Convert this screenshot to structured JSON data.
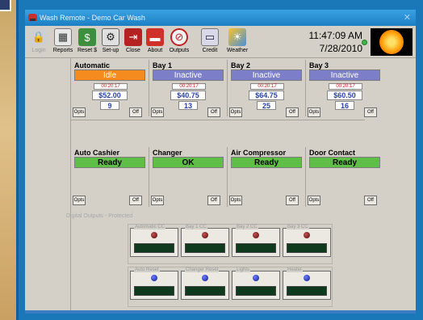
{
  "window": {
    "title": "Wash Remote - Demo Car Wash"
  },
  "toolbar": {
    "buttons": [
      {
        "label": "Login",
        "icon": "lock-icon",
        "enabled": false
      },
      {
        "label": "Reports",
        "icon": "calculator-icon",
        "enabled": true
      },
      {
        "label": "Reset $",
        "icon": "money-icon",
        "enabled": true
      },
      {
        "label": "Set-up",
        "icon": "setup-icon",
        "enabled": true
      },
      {
        "label": "Close",
        "icon": "exit-door-icon",
        "enabled": true
      },
      {
        "label": "About",
        "icon": "car-icon",
        "enabled": true
      },
      {
        "label": "Outputs",
        "icon": "no-outputs-icon",
        "enabled": true
      },
      {
        "label": "Credit",
        "icon": "credit-card-icon",
        "enabled": true
      },
      {
        "label": "Weather",
        "icon": "weather-icon",
        "enabled": true
      }
    ]
  },
  "clock": {
    "time": "11:47:09 AM",
    "date": "7/28/2010"
  },
  "bays": [
    {
      "name": "Automatic",
      "status": "Idle",
      "status_color": "#f58a1f",
      "timer": "00:20:17",
      "amount": "$52.00",
      "count": "9",
      "opts": "Opts",
      "off": "Off"
    },
    {
      "name": "Bay 1",
      "status": "Inactive",
      "status_color": "#7c7fc8",
      "timer": "00:20:17",
      "amount": "$40.75",
      "count": "13",
      "opts": "Opts",
      "off": "Off"
    },
    {
      "name": "Bay 2",
      "status": "Inactive",
      "status_color": "#7c7fc8",
      "timer": "00:20:17",
      "amount": "$64.75",
      "count": "25",
      "opts": "Opts",
      "off": "Off"
    },
    {
      "name": "Bay 3",
      "status": "Inactive",
      "status_color": "#7c7fc8",
      "timer": "00:20:17",
      "amount": "$60.50",
      "count": "16",
      "opts": "Opts",
      "off": "Off"
    }
  ],
  "devices": [
    {
      "name": "Auto Cashier",
      "status": "Ready",
      "opts": "Opts",
      "off": "Off"
    },
    {
      "name": "Changer",
      "status": "OK",
      "opts": "Opts",
      "off": "Off"
    },
    {
      "name": "Air Compressor",
      "status": "Ready",
      "opts": "Opts",
      "off": "Off"
    },
    {
      "name": "Door Contact",
      "status": "Ready",
      "opts": "Opts",
      "off": "Off"
    }
  ],
  "outputs": {
    "section_label": "Digital Outputs - Protected",
    "row1": [
      {
        "label": "Automatic CC",
        "led": "red"
      },
      {
        "label": "Bay 1 CC",
        "led": "red"
      },
      {
        "label": "Bay 2 CC",
        "led": "red"
      },
      {
        "label": "Bay 3 CC",
        "led": "red"
      }
    ],
    "row2": [
      {
        "label": "Auto Reset",
        "led": "blue"
      },
      {
        "label": "Changer Reset",
        "led": "blue"
      },
      {
        "label": "Lights",
        "led": "blue"
      },
      {
        "label": "Heater",
        "led": "blue"
      }
    ]
  }
}
